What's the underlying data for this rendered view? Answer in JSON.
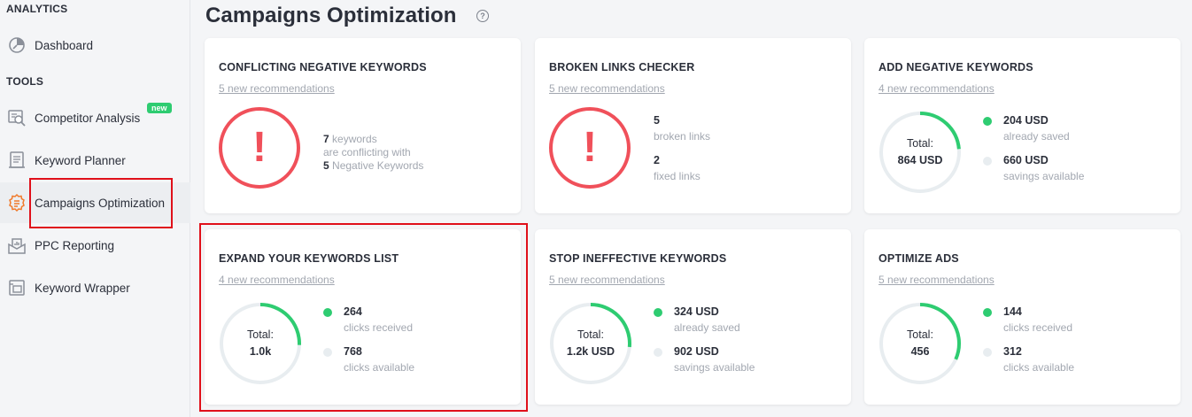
{
  "sidebar": {
    "analytics_label": "ANALYTICS",
    "tools_label": "TOOLS",
    "dashboard": "Dashboard",
    "competitor": "Competitor Analysis",
    "new_badge": "new",
    "keyword_planner": "Keyword Planner",
    "campaigns": "Campaigns Optimization",
    "ppc": "PPC Reporting",
    "wrapper": "Keyword Wrapper"
  },
  "page": {
    "title": "Campaigns Optimization",
    "help": "?"
  },
  "colors": {
    "accent_green": "#2ecc71",
    "alert_red": "#f0505a",
    "track_gray": "#e8edf0",
    "highlight_red": "#e0101a"
  },
  "cards": {
    "conflicting": {
      "title": "CONFLICTING NEGATIVE KEYWORDS",
      "link": "5 new recommendations",
      "alert": "!",
      "count1": "7",
      "text1": "keywords",
      "text2": "are conflicting with",
      "count2": "5",
      "text3": "Negative Keywords"
    },
    "broken": {
      "title": "BROKEN LINKS CHECKER",
      "link": "5 new recommendations",
      "alert": "!",
      "broken_count": "5",
      "broken_label": "broken links",
      "fixed_count": "2",
      "fixed_label": "fixed links"
    },
    "add_negative": {
      "title": "ADD NEGATIVE KEYWORDS",
      "link": "4 new recommendations",
      "total_label": "Total:",
      "total_value": "864 USD",
      "progress": 0.236,
      "val1": "204 USD",
      "label1": "already saved",
      "val2": "660 USD",
      "label2": "savings available"
    },
    "expand": {
      "title": "EXPAND YOUR KEYWORDS LIST",
      "link": "4 new recommendations",
      "total_label": "Total:",
      "total_value": "1.0k",
      "progress": 0.256,
      "val1": "264",
      "label1": "clicks received",
      "val2": "768",
      "label2": "clicks available"
    },
    "stop": {
      "title": "STOP INEFFECTIVE KEYWORDS",
      "link": "5 new recommendations",
      "total_label": "Total:",
      "total_value": "1.2k USD",
      "progress": 0.264,
      "val1": "324 USD",
      "label1": "already saved",
      "val2": "902 USD",
      "label2": "savings available"
    },
    "optimize": {
      "title": "OPTIMIZE ADS",
      "link": "5 new recommendations",
      "total_label": "Total:",
      "total_value": "456",
      "progress": 0.316,
      "val1": "144",
      "label1": "clicks received",
      "val2": "312",
      "label2": "clicks available"
    }
  }
}
